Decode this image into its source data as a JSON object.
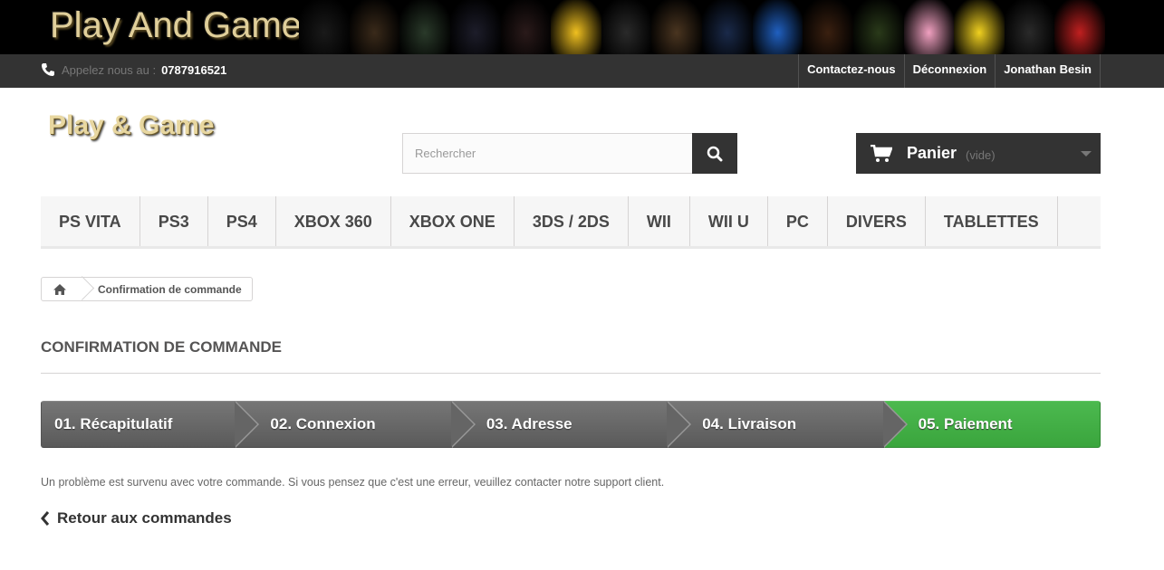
{
  "banner": {
    "title": "Play And Game",
    "art_colors": [
      "#1a1a1a",
      "#3a2a1a",
      "#2a3a2a",
      "#1d1d2a",
      "#2a1a1a",
      "#f0c020",
      "#2a2a2a",
      "#4a3520",
      "#1a2a4a",
      "#2060c0",
      "#3a2010",
      "#2a3a1a",
      "#f0a0c0",
      "#f0d020",
      "#2a2a2a",
      "#c02020"
    ]
  },
  "topbar": {
    "phone_label": "Appelez nous au :",
    "phone_number": "0787916521",
    "links": [
      "Contactez-nous",
      "Déconnexion",
      "Jonathan Besin"
    ]
  },
  "header": {
    "logo": "Play & Game",
    "search_placeholder": "Rechercher",
    "cart_label": "Panier",
    "cart_status": "(vide)"
  },
  "menu": {
    "items": [
      "PS VITA",
      "PS3",
      "PS4",
      "XBOX 360",
      "XBOX ONE",
      "3DS / 2DS",
      "WII",
      "WII U",
      "PC",
      "DIVERS",
      "TABLETTES"
    ]
  },
  "breadcrumb": {
    "current": "Confirmation de commande"
  },
  "page": {
    "heading": "Confirmation de commande",
    "steps": [
      "01. Récapitulatif",
      "02. Connexion",
      "03. Adresse",
      "04. Livraison",
      "05. Paiement"
    ],
    "active_step": 5,
    "message": "Un problème est survenu avec votre commande. Si vous pensez que c'est une erreur, veuillez contacter notre support client.",
    "back_link": "Retour aux commandes"
  },
  "colors": {
    "dark": "#333333",
    "active_step": "#46b04a"
  }
}
